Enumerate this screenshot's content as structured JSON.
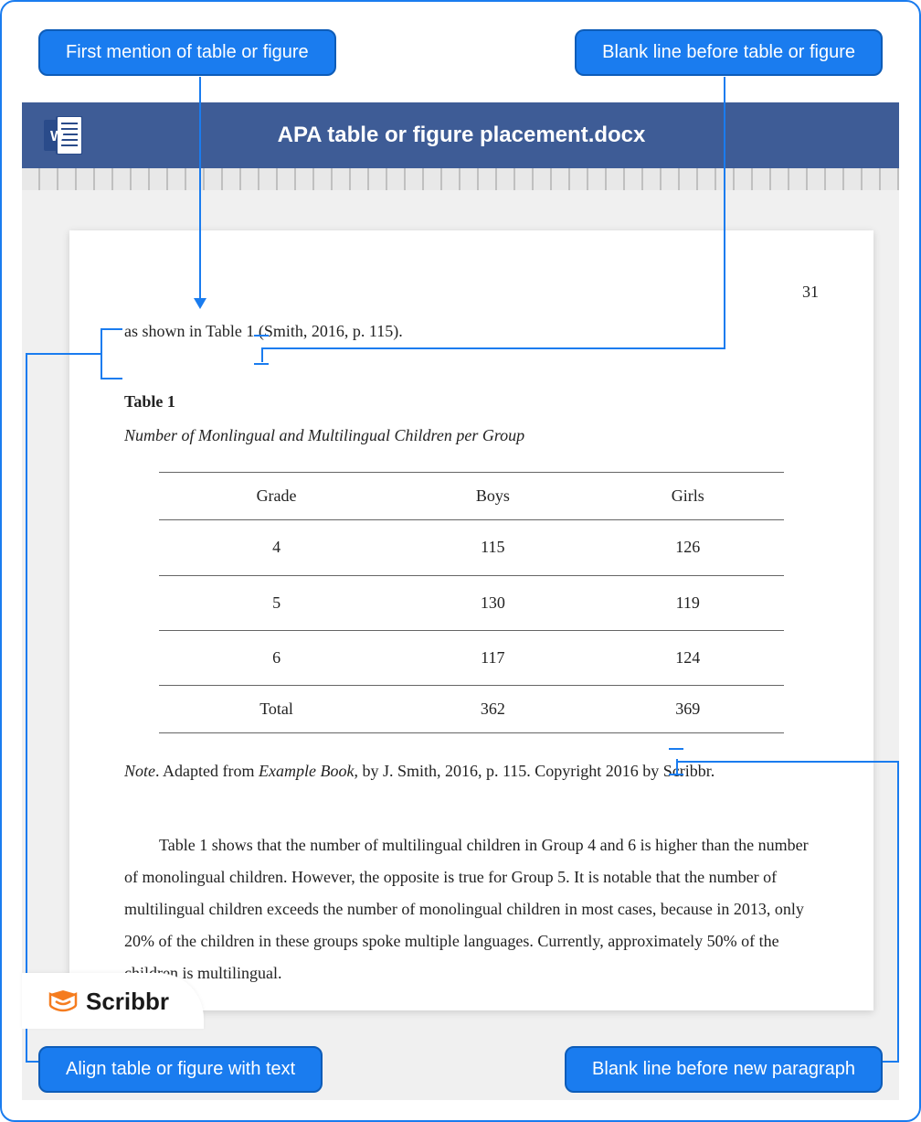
{
  "callouts": {
    "tl": "First mention of table or figure",
    "tr": "Blank line before table or figure",
    "bl": "Align table or figure with text",
    "br": "Blank line before new paragraph"
  },
  "word_title": "APA table or figure placement.docx",
  "page_number": "31",
  "first_line": "as shown in Table 1 (Smith, 2016, p. 115).",
  "table_label": "Table 1",
  "table_title": "Number of Monlingual and Multilingual Children per Group",
  "table_headers": [
    "Grade",
    "Boys",
    "Girls"
  ],
  "table_rows": [
    [
      "4",
      "115",
      "126"
    ],
    [
      "5",
      "130",
      "119"
    ],
    [
      "6",
      "117",
      "124"
    ]
  ],
  "table_total": [
    "Total",
    "362",
    "369"
  ],
  "note_prefix": "Note",
  "note_text1": ". Adapted from ",
  "note_book": "Example Book",
  "note_text2": ", by J. Smith, 2016, p. 115. Copyright 2016 by Scribbr.",
  "paragraph": "Table 1 shows that the number of multilingual children in Group 4 and 6 is higher than the number of monolingual children. However, the opposite is true for Group 5. It is notable that the number of multilingual children exceeds the number of monolingual children in most cases, because in 2013, only 20% of the children in these groups spoke multiple languages. Currently, approximately 50% of the children is multilingual.",
  "brand": "Scribbr"
}
